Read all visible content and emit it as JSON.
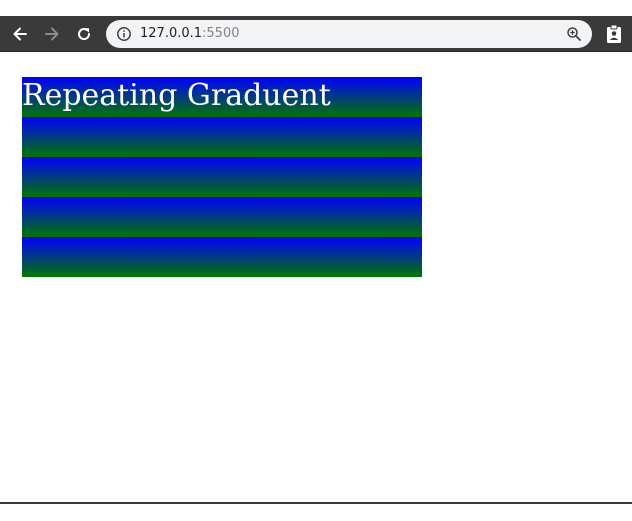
{
  "browser": {
    "url_host": "127.0.0.1",
    "url_port": ":5500",
    "icons": {
      "back": "arrow-left-icon",
      "forward": "arrow-right-icon",
      "reload": "reload-icon",
      "site_info": "info-icon",
      "zoom": "zoom-in-icon",
      "extension": "clipboard-user-icon"
    },
    "colors": {
      "toolbar": "#3a3a3a",
      "omnibox": "#f1f3f4"
    }
  },
  "page": {
    "heading": "Repeating Graduent",
    "gradient_colors": [
      "#0000ff",
      "#007700"
    ]
  }
}
